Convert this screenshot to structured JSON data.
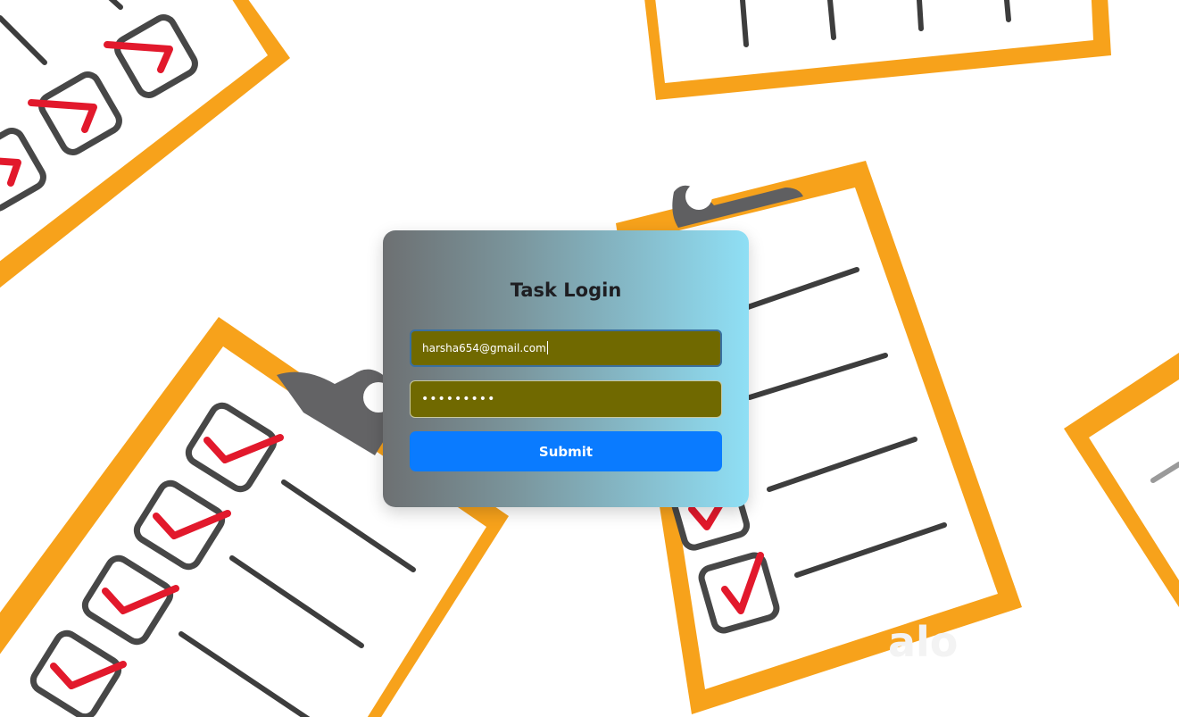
{
  "login": {
    "title": "Task Login",
    "email_value": "harsha654@gmail.com",
    "password_mask": "•••••••••",
    "submit_label": "Submit"
  },
  "colors": {
    "card_gradient_start": "#6d7072",
    "card_gradient_end": "#8fdff5",
    "input_background": "#706900",
    "submit_background": "#0a7bff",
    "clipboard_frame": "#f7a21b",
    "checkmark": "#e2192c"
  },
  "background": {
    "watermark_fragment": "alo"
  }
}
